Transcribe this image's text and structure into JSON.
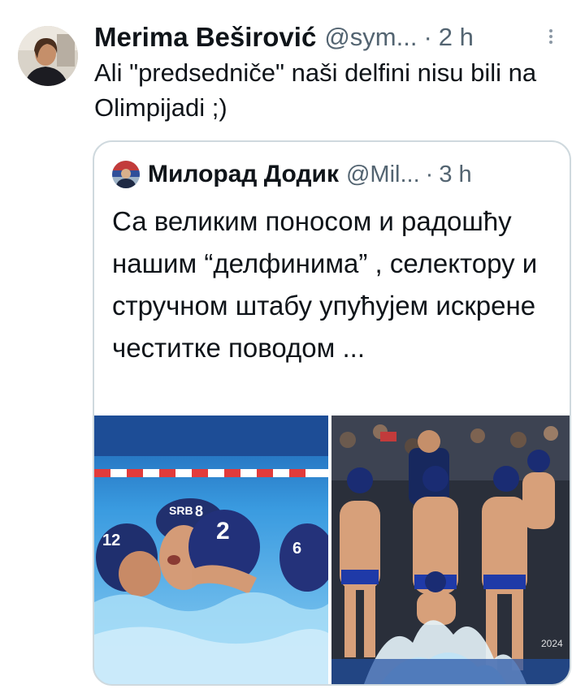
{
  "tweet": {
    "author_name": "Merima Beširović",
    "handle": "@sym...",
    "separator": "·",
    "time": "2 h",
    "text": "Ali \"predsedniče\" naši delfini nisu bili na Olimpijadi ;)"
  },
  "quoted_tweet": {
    "author_name": "Милорад Додик",
    "handle": "@Mil...",
    "separator": "·",
    "time": "3 h",
    "text": "Са великим поносом и радошћу нашим “делфинима” , селектору и стручном штабу упућујем искрене честитке поводом ..."
  },
  "media": {
    "image_1": {
      "cap_numbers": [
        "8",
        "12",
        "2",
        "6"
      ],
      "cap_text": "SRB"
    },
    "image_2": {
      "watermark": "2024"
    }
  },
  "icons": {
    "more": "more-vertical-icon"
  },
  "colors": {
    "text_primary": "#0f1419",
    "text_secondary": "#536471",
    "border": "#cfd9de",
    "pool_blue": "#2d8fd8",
    "cap_navy": "#17285e"
  }
}
